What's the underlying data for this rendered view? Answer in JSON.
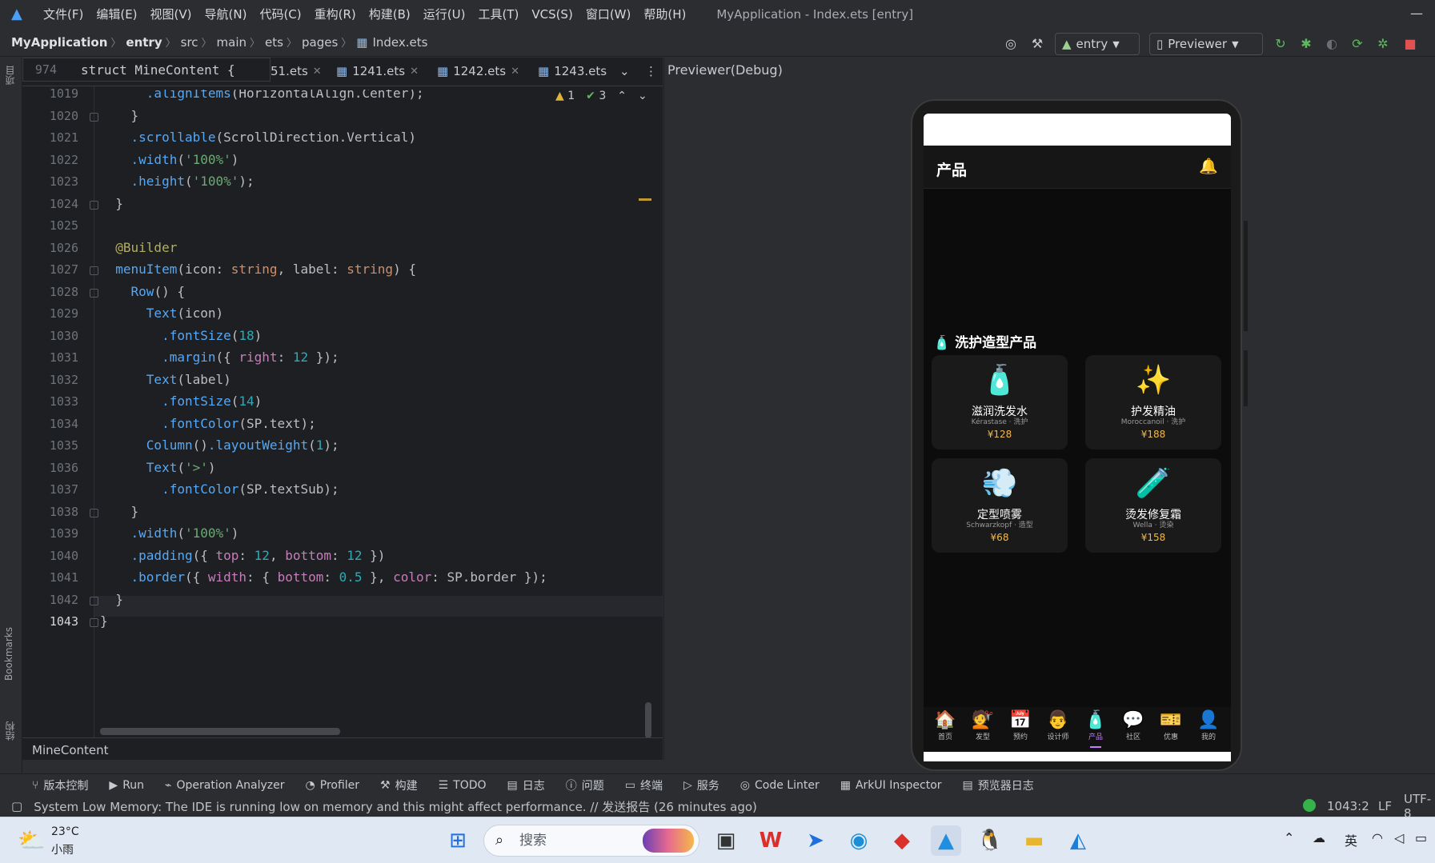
{
  "menubar": {
    "items": [
      "文件(F)",
      "编辑(E)",
      "视图(V)",
      "导航(N)",
      "代码(C)",
      "重构(R)",
      "构建(B)",
      "运行(U)",
      "工具(T)",
      "VCS(S)",
      "窗口(W)",
      "帮助(H)"
    ],
    "window_title": "MyApplication - Index.ets [entry]"
  },
  "breadcrumb": [
    "MyApplication",
    "entry",
    "src",
    "main",
    "ets",
    "pages",
    "Index.ets"
  ],
  "toolbar": {
    "module_select": "entry",
    "device_select": "Previewer"
  },
  "editor": {
    "sticky_line_number": "974",
    "sticky_code": "struct MineContent {",
    "tabs": [
      "51.ets",
      "1241.ets",
      "1242.ets",
      "1243.ets"
    ],
    "inspection": {
      "warnings": "1",
      "ok": "3"
    },
    "line_numbers": [
      "1019",
      "1020",
      "1021",
      "1022",
      "1023",
      "1024",
      "1025",
      "1026",
      "1027",
      "1028",
      "1029",
      "1030",
      "1031",
      "1032",
      "1033",
      "1034",
      "1035",
      "1036",
      "1037",
      "1038",
      "1039",
      "1040",
      "1041",
      "1042",
      "1043"
    ],
    "code_lines": [
      "      .alignItems(HorizontalAlign.Center);",
      "    }",
      "    .scrollable(ScrollDirection.Vertical)",
      "    .width('100%')",
      "    .height('100%');",
      "  }",
      "",
      "  @Builder",
      "  menuItem(icon: string, label: string) {",
      "    Row() {",
      "      Text(icon)",
      "        .fontSize(18)",
      "        .margin({ right: 12 });",
      "      Text(label)",
      "        .fontSize(14)",
      "        .fontColor(SP.text);",
      "      Column().layoutWeight(1);",
      "      Text('>')",
      "        .fontColor(SP.textSub);",
      "    }",
      "    .width('100%')",
      "    .padding({ top: 12, bottom: 12 })",
      "    .border({ width: { bottom: 0.5 }, color: SP.border });",
      "  }",
      "}"
    ],
    "bottom_breadcrumb": "MineContent"
  },
  "left_strip": {
    "project": "项目",
    "bookmarks": "Bookmarks",
    "structure": "结构"
  },
  "previewer": {
    "title": "Previewer(Debug)",
    "app": {
      "page_title": "产品",
      "section_title": "洗护造型产品",
      "products": [
        {
          "icon": "🧴",
          "name": "滋润洗发水",
          "brand": "Kérastase · 洗护",
          "price": "¥128"
        },
        {
          "icon": "✨",
          "name": "护发精油",
          "brand": "Moroccanoil · 洗护",
          "price": "¥188"
        },
        {
          "icon": "💨",
          "name": "定型喷雾",
          "brand": "Schwarzkopf · 造型",
          "price": "¥68"
        },
        {
          "icon": "🧪",
          "name": "烫发修复霜",
          "brand": "Wella · 烫染",
          "price": "¥158"
        }
      ],
      "bottom_nav": [
        {
          "icon": "🏠",
          "label": "首页"
        },
        {
          "icon": "💇",
          "label": "发型"
        },
        {
          "icon": "📅",
          "label": "预约"
        },
        {
          "icon": "👨",
          "label": "设计师"
        },
        {
          "icon": "🧴",
          "label": "产品"
        },
        {
          "icon": "💬",
          "label": "社区"
        },
        {
          "icon": "🎫",
          "label": "优惠"
        },
        {
          "icon": "👤",
          "label": "我的"
        }
      ],
      "active_tab": "产品"
    }
  },
  "tool_windows": [
    "版本控制",
    "Run",
    "Operation Analyzer",
    "Profiler",
    "构建",
    "TODO",
    "日志",
    "问题",
    "终端",
    "服务",
    "Code Linter",
    "ArkUI Inspector",
    "预览器日志"
  ],
  "status": {
    "message": "System Low Memory: The IDE is running low on memory and this might affect performance. // 发送报告 (26 minutes ago)",
    "position": "1043:2",
    "line_ending": "LF",
    "encoding": "UTF-8"
  },
  "taskbar": {
    "weather_temp": "23°C",
    "weather_desc": "小雨",
    "search_placeholder": "搜索",
    "ime": "英"
  },
  "colors": {
    "accent": "#c77dff",
    "price": "#f5b84a",
    "ide_bg": "#1e1f22"
  }
}
